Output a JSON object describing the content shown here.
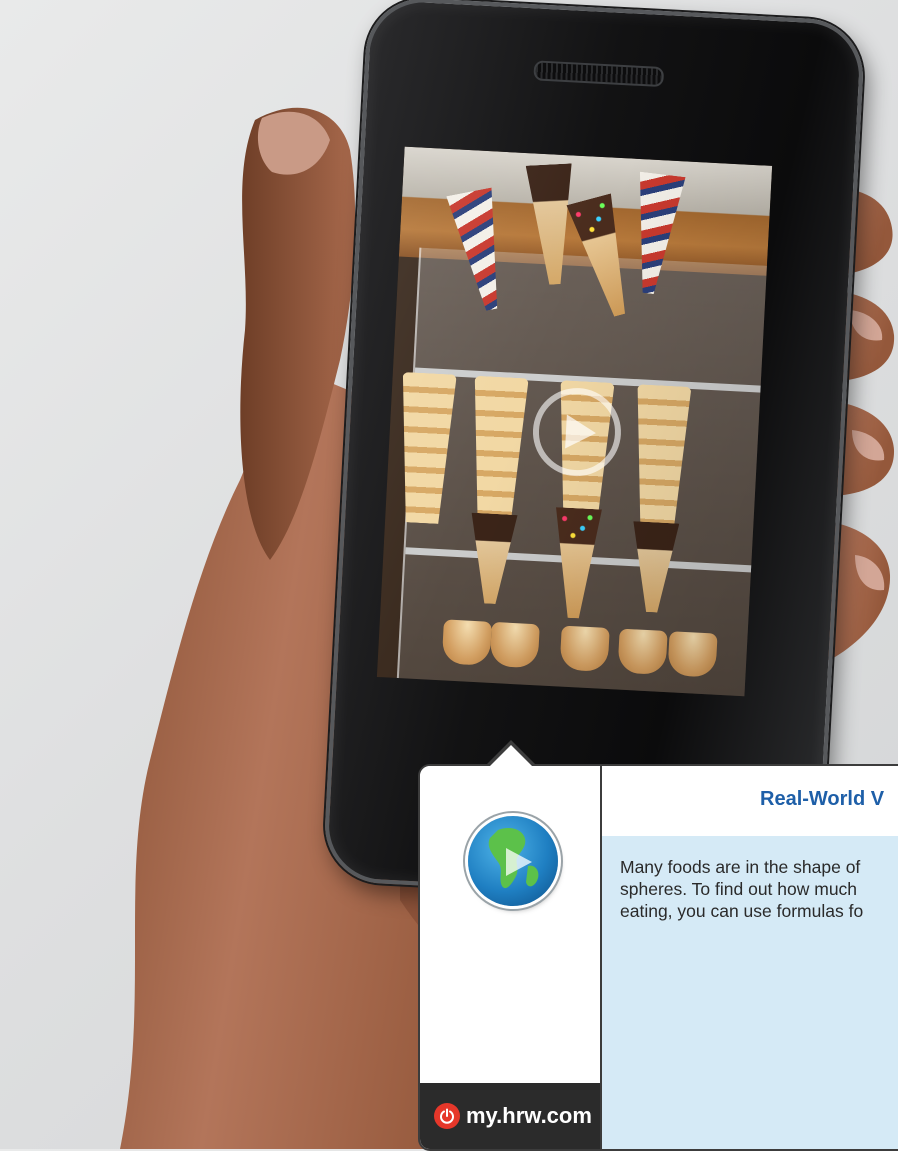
{
  "callout": {
    "title": "Real-World V",
    "lines": [
      "Many foods are in the shape of",
      "spheres. To find out how much",
      "eating, you can use formulas fo"
    ],
    "url": "my.hrw.com"
  },
  "icons": {
    "play": "play-icon",
    "globe": "globe-video-icon",
    "power": "power-icon"
  },
  "colors": {
    "title_blue": "#1e5fa8",
    "panel_blue": "#d5eaf6",
    "url_bar": "#2b2b2b",
    "power_red": "#e6372a"
  }
}
